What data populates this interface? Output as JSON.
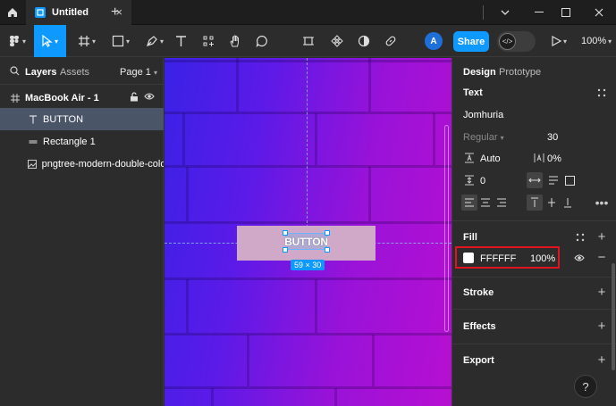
{
  "titlebar": {
    "tab_title": "Untitled",
    "new_tab": "+",
    "close_tab": "×"
  },
  "toolbar": {
    "avatar_initial": "A",
    "share_label": "Share",
    "zoom": "100%"
  },
  "layers_panel": {
    "tab_layers": "Layers",
    "tab_assets": "Assets",
    "page_selector": "Page 1",
    "frame": {
      "name": "MacBook Air - 1"
    },
    "items": [
      {
        "name": "BUTTON",
        "icon": "text-icon",
        "selected": true
      },
      {
        "name": "Rectangle 1",
        "icon": "rectangle-icon",
        "selected": false
      },
      {
        "name": "pngtree-modern-double-color...",
        "icon": "image-icon",
        "selected": false
      }
    ]
  },
  "canvas": {
    "button_text": "BUTTON",
    "dimensions_badge": "59 × 30",
    "background_colors": [
      "#3a22e6",
      "#9a12d8",
      "#b70fd1"
    ],
    "rectangle_color": "#d0a9c8",
    "selection_color": "#0d99ff"
  },
  "design_panel": {
    "tab_design": "Design",
    "tab_prototype": "Prototype",
    "text_section": {
      "title": "Text",
      "font_family": "Jomhuria",
      "font_weight": "Regular",
      "font_size": "30",
      "line_height": "Auto",
      "letter_spacing": "0%",
      "paragraph_spacing": "0"
    },
    "fill_section": {
      "title": "Fill",
      "hex": "FFFFFF",
      "opacity": "100%",
      "highlight_color": "#e0141e"
    },
    "stroke_title": "Stroke",
    "effects_title": "Effects",
    "export_title": "Export"
  },
  "help_label": "?"
}
